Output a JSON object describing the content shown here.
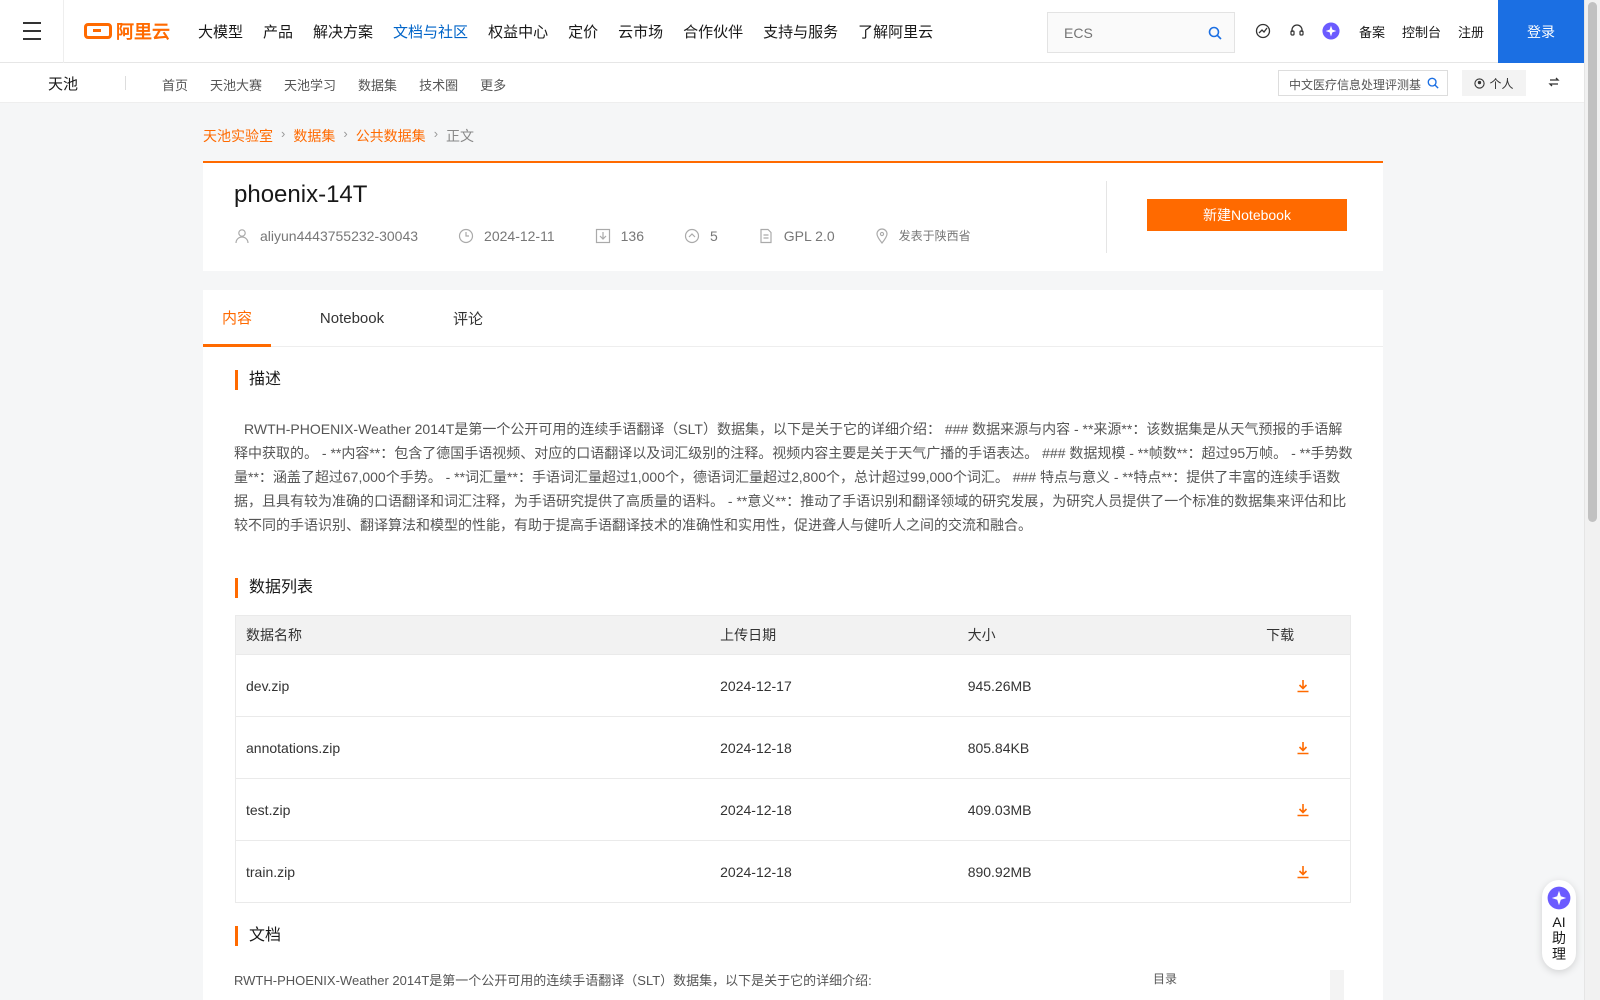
{
  "topnav": {
    "logo_text": "阿里云",
    "items": [
      "大模型",
      "产品",
      "解决方案",
      "文档与社区",
      "权益中心",
      "定价",
      "云市场",
      "合作伙伴",
      "支持与服务",
      "了解阿里云"
    ],
    "active_index": 3,
    "search_placeholder": "ECS",
    "links": [
      "备案",
      "控制台",
      "注册"
    ],
    "login_label": "登录",
    "accent": "#ff6a00",
    "active_color": "#0064c8"
  },
  "subnav": {
    "brand": "天池",
    "links": [
      "首页",
      "天池大赛",
      "天池学习",
      "数据集",
      "技术圈",
      "更多"
    ],
    "search_value": "中文医疗信息处理评测基",
    "personal_label": "个人"
  },
  "breadcrumb": [
    "天池实验室",
    "数据集",
    "公共数据集",
    "正文"
  ],
  "dataset": {
    "title": "phoenix-14T",
    "author": "aliyun4443755232-30043",
    "date": "2024-12-11",
    "downloads": "136",
    "favorites": "5",
    "license": "GPL 2.0",
    "location": "发表于陕西省",
    "notebook_button": "新建Notebook"
  },
  "tabs": [
    "内容",
    "Notebook",
    "评论"
  ],
  "sections": {
    "description_title": "描述",
    "description": "RWTH-PHOENIX-Weather 2014T是第一个公开可用的连续手语翻译（SLT）数据集，以下是关于它的详细介绍： ### 数据来源与内容 - **来源**：该数据集是从天气预报的手语解释中获取的。 - **内容**：包含了德国手语视频、对应的口语翻译以及词汇级别的注释。视频内容主要是关于天气广播的手语表达。 ### 数据规模 - **帧数**：超过95万帧。 - **手势数量**：涵盖了超过67,000个手势。 - **词汇量**：手语词汇量超过1,000个，德语词汇量超过2,800个，总计超过99,000个词汇。 ### 特点与意义 - **特点**：提供了丰富的连续手语数据，且具有较为准确的口语翻译和词汇注释，为手语研究提供了高质量的语料。 - **意义**：推动了手语识别和翻译领域的研究发展，为研究人员提供了一个标准的数据集来评估和比较不同的手语识别、翻译算法和模型的性能，有助于提高手语翻译技术的准确性和实用性，促进聋人与健听人之间的交流和融合。",
    "datalist_title": "数据列表",
    "doc_title": "文档",
    "doc_preview": "RWTH-PHOENIX-Weather 2014T是第一个公开可用的连续手语翻译（SLT）数据集，以下是关于它的详细介绍:",
    "toc_label": "目录"
  },
  "table": {
    "headers": [
      "数据名称",
      "上传日期",
      "大小",
      "下载"
    ],
    "rows": [
      {
        "name": "dev.zip",
        "date": "2024-12-17",
        "size": "945.26MB"
      },
      {
        "name": "annotations.zip",
        "date": "2024-12-18",
        "size": "805.84KB"
      },
      {
        "name": "test.zip",
        "date": "2024-12-18",
        "size": "409.03MB"
      },
      {
        "name": "train.zip",
        "date": "2024-12-18",
        "size": "890.92MB"
      }
    ]
  },
  "ai_assistant": {
    "label": "AI助理"
  }
}
